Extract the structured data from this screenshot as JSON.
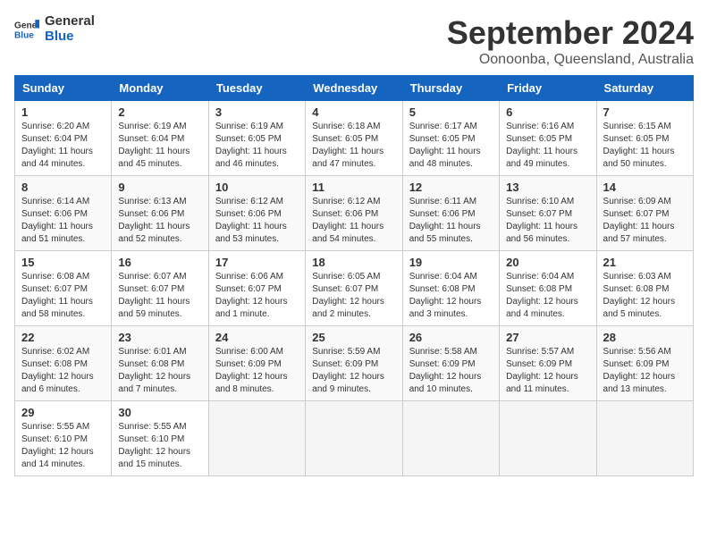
{
  "header": {
    "logo_line1": "General",
    "logo_line2": "Blue",
    "month": "September 2024",
    "location": "Oonoonba, Queensland, Australia"
  },
  "weekdays": [
    "Sunday",
    "Monday",
    "Tuesday",
    "Wednesday",
    "Thursday",
    "Friday",
    "Saturday"
  ],
  "weeks": [
    [
      {
        "day": "1",
        "info": "Sunrise: 6:20 AM\nSunset: 6:04 PM\nDaylight: 11 hours\nand 44 minutes."
      },
      {
        "day": "2",
        "info": "Sunrise: 6:19 AM\nSunset: 6:04 PM\nDaylight: 11 hours\nand 45 minutes."
      },
      {
        "day": "3",
        "info": "Sunrise: 6:19 AM\nSunset: 6:05 PM\nDaylight: 11 hours\nand 46 minutes."
      },
      {
        "day": "4",
        "info": "Sunrise: 6:18 AM\nSunset: 6:05 PM\nDaylight: 11 hours\nand 47 minutes."
      },
      {
        "day": "5",
        "info": "Sunrise: 6:17 AM\nSunset: 6:05 PM\nDaylight: 11 hours\nand 48 minutes."
      },
      {
        "day": "6",
        "info": "Sunrise: 6:16 AM\nSunset: 6:05 PM\nDaylight: 11 hours\nand 49 minutes."
      },
      {
        "day": "7",
        "info": "Sunrise: 6:15 AM\nSunset: 6:05 PM\nDaylight: 11 hours\nand 50 minutes."
      }
    ],
    [
      {
        "day": "8",
        "info": "Sunrise: 6:14 AM\nSunset: 6:06 PM\nDaylight: 11 hours\nand 51 minutes."
      },
      {
        "day": "9",
        "info": "Sunrise: 6:13 AM\nSunset: 6:06 PM\nDaylight: 11 hours\nand 52 minutes."
      },
      {
        "day": "10",
        "info": "Sunrise: 6:12 AM\nSunset: 6:06 PM\nDaylight: 11 hours\nand 53 minutes."
      },
      {
        "day": "11",
        "info": "Sunrise: 6:12 AM\nSunset: 6:06 PM\nDaylight: 11 hours\nand 54 minutes."
      },
      {
        "day": "12",
        "info": "Sunrise: 6:11 AM\nSunset: 6:06 PM\nDaylight: 11 hours\nand 55 minutes."
      },
      {
        "day": "13",
        "info": "Sunrise: 6:10 AM\nSunset: 6:07 PM\nDaylight: 11 hours\nand 56 minutes."
      },
      {
        "day": "14",
        "info": "Sunrise: 6:09 AM\nSunset: 6:07 PM\nDaylight: 11 hours\nand 57 minutes."
      }
    ],
    [
      {
        "day": "15",
        "info": "Sunrise: 6:08 AM\nSunset: 6:07 PM\nDaylight: 11 hours\nand 58 minutes."
      },
      {
        "day": "16",
        "info": "Sunrise: 6:07 AM\nSunset: 6:07 PM\nDaylight: 11 hours\nand 59 minutes."
      },
      {
        "day": "17",
        "info": "Sunrise: 6:06 AM\nSunset: 6:07 PM\nDaylight: 12 hours\nand 1 minute."
      },
      {
        "day": "18",
        "info": "Sunrise: 6:05 AM\nSunset: 6:07 PM\nDaylight: 12 hours\nand 2 minutes."
      },
      {
        "day": "19",
        "info": "Sunrise: 6:04 AM\nSunset: 6:08 PM\nDaylight: 12 hours\nand 3 minutes."
      },
      {
        "day": "20",
        "info": "Sunrise: 6:04 AM\nSunset: 6:08 PM\nDaylight: 12 hours\nand 4 minutes."
      },
      {
        "day": "21",
        "info": "Sunrise: 6:03 AM\nSunset: 6:08 PM\nDaylight: 12 hours\nand 5 minutes."
      }
    ],
    [
      {
        "day": "22",
        "info": "Sunrise: 6:02 AM\nSunset: 6:08 PM\nDaylight: 12 hours\nand 6 minutes."
      },
      {
        "day": "23",
        "info": "Sunrise: 6:01 AM\nSunset: 6:08 PM\nDaylight: 12 hours\nand 7 minutes."
      },
      {
        "day": "24",
        "info": "Sunrise: 6:00 AM\nSunset: 6:09 PM\nDaylight: 12 hours\nand 8 minutes."
      },
      {
        "day": "25",
        "info": "Sunrise: 5:59 AM\nSunset: 6:09 PM\nDaylight: 12 hours\nand 9 minutes."
      },
      {
        "day": "26",
        "info": "Sunrise: 5:58 AM\nSunset: 6:09 PM\nDaylight: 12 hours\nand 10 minutes."
      },
      {
        "day": "27",
        "info": "Sunrise: 5:57 AM\nSunset: 6:09 PM\nDaylight: 12 hours\nand 11 minutes."
      },
      {
        "day": "28",
        "info": "Sunrise: 5:56 AM\nSunset: 6:09 PM\nDaylight: 12 hours\nand 13 minutes."
      }
    ],
    [
      {
        "day": "29",
        "info": "Sunrise: 5:55 AM\nSunset: 6:10 PM\nDaylight: 12 hours\nand 14 minutes."
      },
      {
        "day": "30",
        "info": "Sunrise: 5:55 AM\nSunset: 6:10 PM\nDaylight: 12 hours\nand 15 minutes."
      },
      {
        "day": "",
        "info": ""
      },
      {
        "day": "",
        "info": ""
      },
      {
        "day": "",
        "info": ""
      },
      {
        "day": "",
        "info": ""
      },
      {
        "day": "",
        "info": ""
      }
    ]
  ]
}
